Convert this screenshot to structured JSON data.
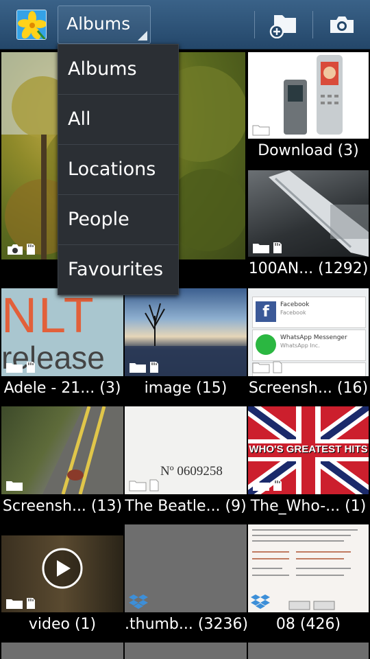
{
  "actionbar": {
    "spinner_label": "Albums",
    "icons": [
      "gallery-app-icon",
      "new-folder-icon",
      "camera-icon"
    ]
  },
  "albums": [
    {
      "name": "Camera",
      "caption": ""
    },
    {
      "name": "Download",
      "caption": "Download (3)"
    },
    {
      "name": "100ANDRO",
      "caption": "100AN... (1292)"
    },
    {
      "name": "Adele",
      "caption": "Adele - 21... (3)"
    },
    {
      "name": "image",
      "caption": "image (15)"
    },
    {
      "name": "Screenshots-1",
      "caption": "Screensh... (16)"
    },
    {
      "name": "Screenshots-2",
      "caption": "Screensh... (13)"
    },
    {
      "name": "The Beatles",
      "caption": "The Beatle... (9)"
    },
    {
      "name": "The_Who",
      "caption": "The_Who-... (1)"
    },
    {
      "name": "video",
      "caption": "video (1)"
    },
    {
      "name": ".thumbnails",
      "caption": ".thumb... (3236)"
    },
    {
      "name": "08",
      "caption": "08 (426)"
    }
  ],
  "thumb_text": {
    "nlt": "NLT",
    "release": "release",
    "facebook": "Facebook",
    "whatsapp": "WhatsApp Messenger",
    "facebook_sub": "Facebook",
    "whatsapp_sub": "WhatsApp Inc.",
    "stamp": "Nº 0609258",
    "who_title": "WHO'S GREATEST HITS"
  },
  "dropdown": {
    "items": [
      "Albums",
      "All",
      "Locations",
      "People",
      "Favourites"
    ]
  }
}
